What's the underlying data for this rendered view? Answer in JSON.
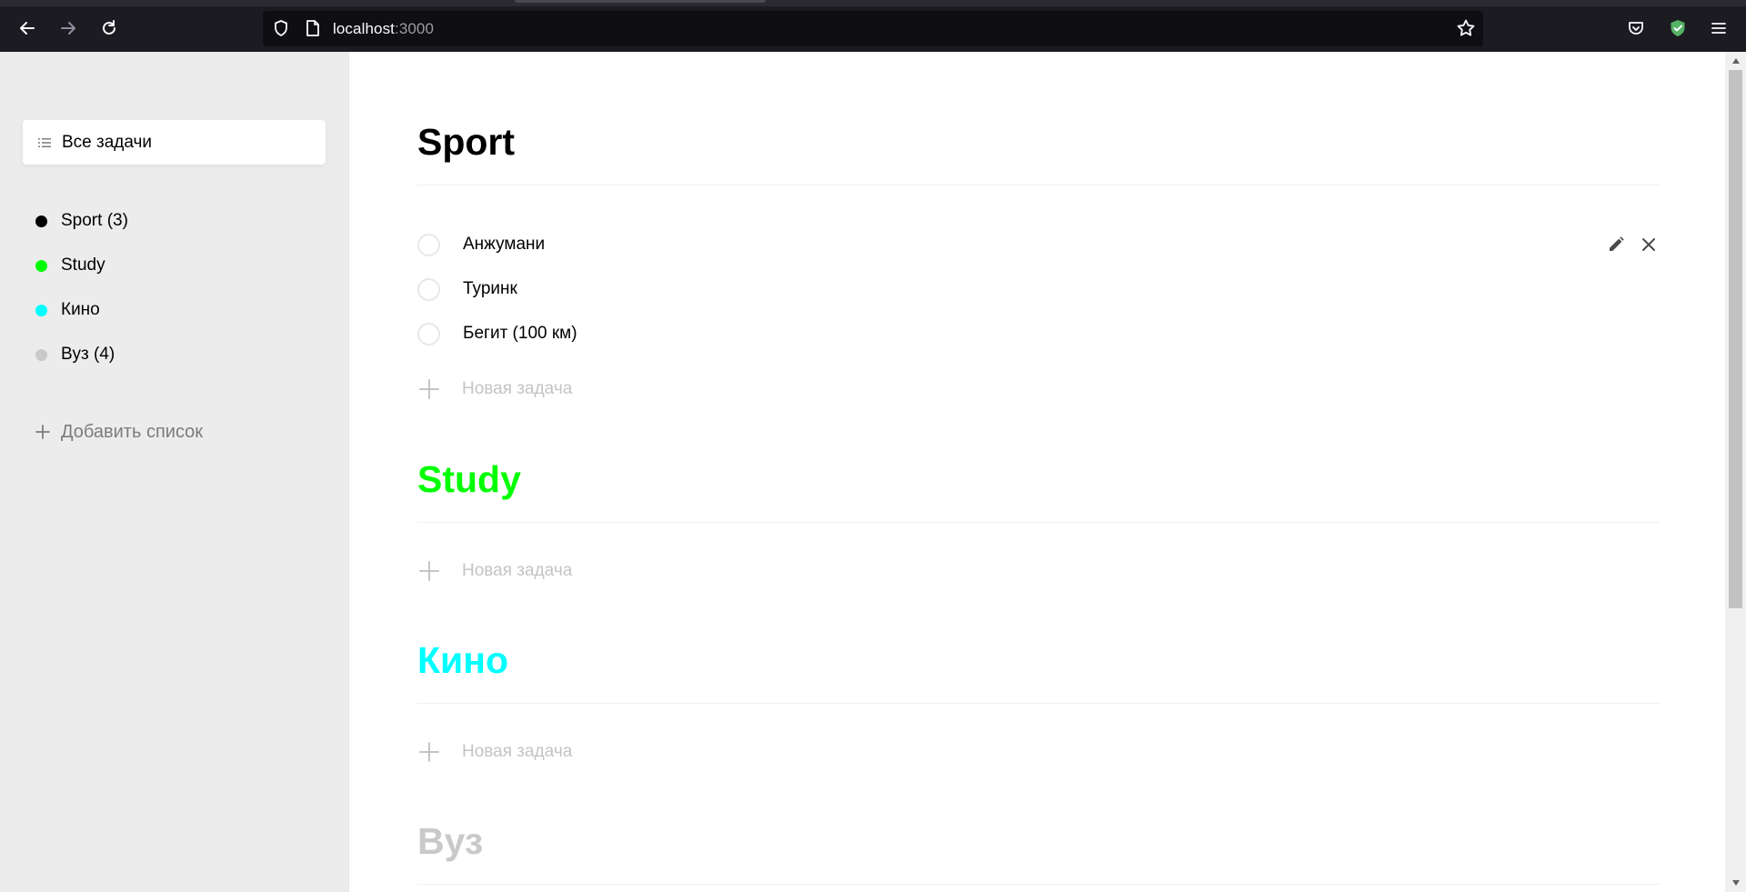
{
  "browser": {
    "url_host": "localhost",
    "url_port": ":3000"
  },
  "sidebar": {
    "all_tasks_label": "Все задачи",
    "lists": [
      {
        "label": "Sport (3)",
        "color": "#000000"
      },
      {
        "label": "Study",
        "color": "#00ff00"
      },
      {
        "label": "Кино",
        "color": "#00ffff"
      },
      {
        "label": "Вуз (4)",
        "color": "#c9c9c9"
      }
    ],
    "add_list_label": "Добавить список"
  },
  "main": {
    "sections": [
      {
        "title": "Sport",
        "color": "#000000",
        "tasks": [
          "Анжумани",
          "Туринк",
          "Бегит (100 км)"
        ],
        "new_task_label": "Новая задача"
      },
      {
        "title": "Study",
        "color": "#00ff00",
        "tasks": [],
        "new_task_label": "Новая задача"
      },
      {
        "title": "Кино",
        "color": "#00ffff",
        "tasks": [],
        "new_task_label": "Новая задача"
      },
      {
        "title": "Вуз",
        "color": "#c9c9c9",
        "tasks": []
      }
    ]
  },
  "icons": {
    "back": "back-arrow-icon",
    "forward": "forward-arrow-icon",
    "reload": "reload-icon",
    "shield": "shield-icon",
    "page": "page-icon",
    "star": "bookmark-star-icon",
    "pocket": "pocket-icon",
    "extension": "shield-extension-icon",
    "menu": "hamburger-menu-icon",
    "edit": "pencil-icon",
    "delete": "close-icon"
  }
}
